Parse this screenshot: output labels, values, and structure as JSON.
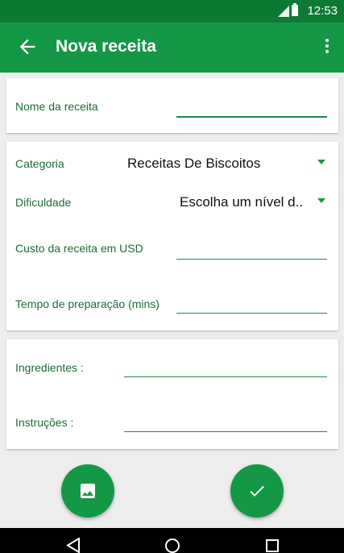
{
  "status": {
    "time": "12:53"
  },
  "appbar": {
    "title": "Nova receita"
  },
  "card1": {
    "recipe_name_label": "Nome da receita"
  },
  "card2": {
    "category_label": "Categoria",
    "category_value": "Receitas De Biscoitos",
    "difficulty_label": "Dificuldade",
    "difficulty_value": "Escolha um nível d..",
    "cost_label": "Custo da receita em USD",
    "time_label": "Tempo de preparação (mins)"
  },
  "card3": {
    "ingredients_label": "Ingredientes :",
    "instructions_label": "Instruções :"
  },
  "icons": {
    "back": "arrow-left-icon",
    "menu": "more-vert-icon",
    "image": "image-icon",
    "check": "check-icon"
  },
  "colors": {
    "primary": "#159846",
    "statusbar": "#0d7a33",
    "accent_text": "#1e6b3a"
  }
}
